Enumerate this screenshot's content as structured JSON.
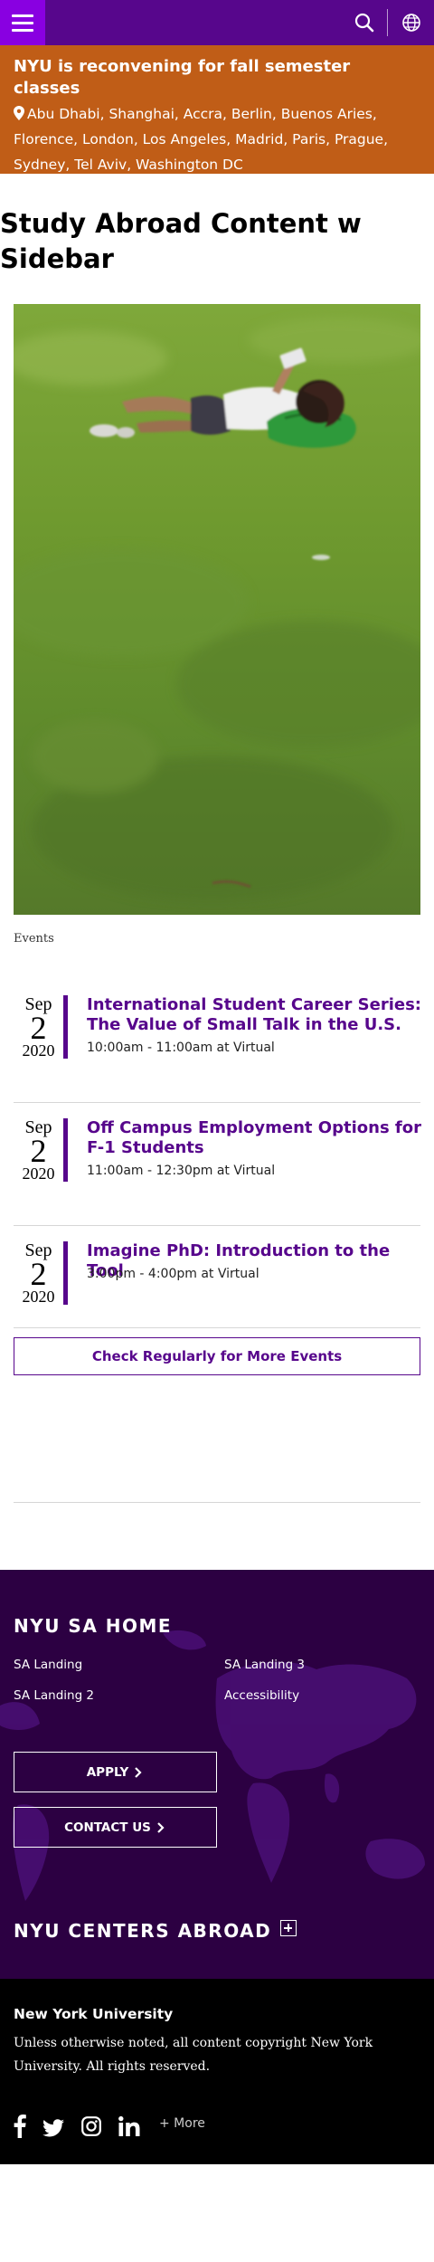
{
  "header": {
    "menu_icon": "hamburger-icon",
    "search_icon": "search-icon",
    "language_icon": "globe-icon",
    "brand_color": "#57068c",
    "menu_color": "#8900e1"
  },
  "alert": {
    "title": "NYU is reconvening for fall semester classes",
    "locations": "Abu Dhabi, Shanghai, Accra, Berlin, Buenos Aries, Florence, London, Los Angeles, Madrid, Paris, Prague, Sydney, Tel Aviv, Washington DC",
    "pin_icon": "map-pin-icon",
    "color": "#c05d17"
  },
  "page": {
    "title": "Study Abroad Content w Sidebar",
    "image_caption": "Events"
  },
  "events": [
    {
      "month": "Sep",
      "day": "2",
      "year": "2020",
      "title": "International Student Career Series: The Value of Small Talk in the U.S.",
      "time": "10:00am - 11:00am at Virtual"
    },
    {
      "month": "Sep",
      "day": "2",
      "year": "2020",
      "title": "Off Campus Employment Options for F-1 Students",
      "time": "11:00am - 12:30pm at Virtual"
    },
    {
      "month": "Sep",
      "day": "2",
      "year": "2020",
      "title": "Imagine PhD: Introduction to the Tool",
      "time": "3:00pm - 4:00pm at Virtual"
    }
  ],
  "more_events_label": "Check Regularly for More Events",
  "footer": {
    "home_title": "NYU SA HOME",
    "links": [
      "SA Landing",
      "SA Landing 3",
      "SA Landing 2",
      "Accessibility"
    ],
    "apply_label": "APPLY",
    "contact_label": "CONTACT US",
    "centers_title": "NYU CENTERS ABROAD",
    "background_color": "#2c0042"
  },
  "bottom": {
    "title": "New York University",
    "copyright": "Unless otherwise noted, all content copyright New York University. All rights reserved.",
    "social": [
      "facebook-icon",
      "twitter-icon",
      "instagram-icon",
      "linkedin-icon"
    ],
    "more_label": "+ More"
  }
}
